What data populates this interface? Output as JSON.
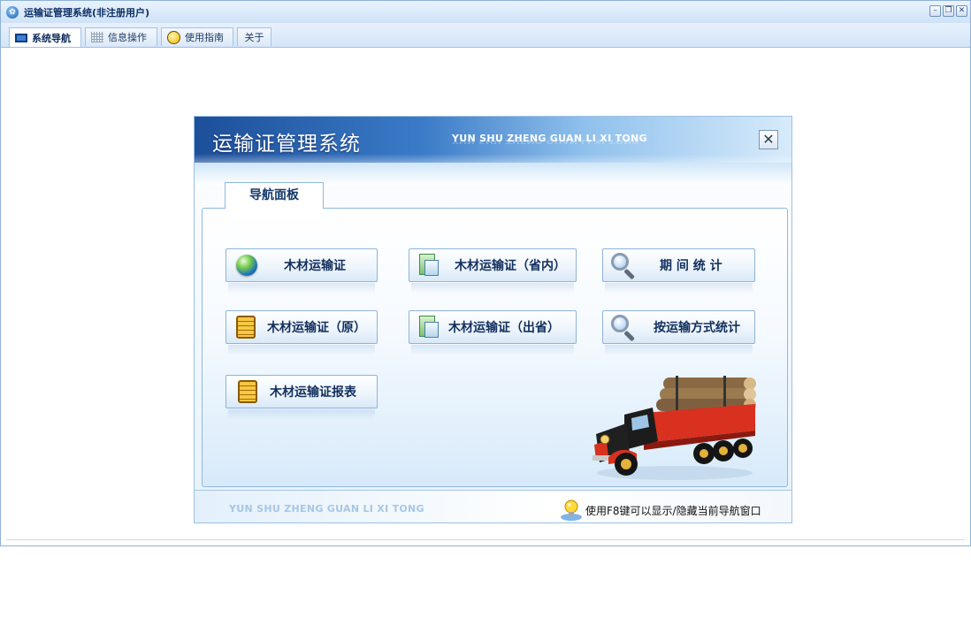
{
  "window": {
    "title": "运输证管理系统(非注册用户)",
    "app_icon": "app-logo-icon",
    "controls": {
      "minimize": "–",
      "restore": "❐",
      "close": "✕"
    }
  },
  "tabs": [
    {
      "label": "系统导航",
      "icon": "monitor-icon",
      "active": true
    },
    {
      "label": "信息操作",
      "icon": "grid-icon",
      "active": false
    },
    {
      "label": "使用指南",
      "icon": "help-icon",
      "active": false
    },
    {
      "label": "关于",
      "icon": "",
      "active": false
    }
  ],
  "dialog": {
    "title": "运输证管理系统",
    "subtitle": "YUN SHU ZHENG GUAN LI XI TONG",
    "close_label": "✕",
    "panel_tab": "导航面板",
    "buttons": {
      "b1": {
        "label": "木材运输证",
        "icon": "globe-icon"
      },
      "b2": {
        "label": "木材运输证（省内）",
        "icon": "card-icon"
      },
      "b3": {
        "label": "期 间 统 计",
        "icon": "magnifier-icon"
      },
      "b4": {
        "label": "木材运输证（原）",
        "icon": "document-icon"
      },
      "b5": {
        "label": "木材运输证（出省）",
        "icon": "card-icon"
      },
      "b6": {
        "label": "按运输方式统计",
        "icon": "magnifier-icon"
      },
      "b7": {
        "label": "木材运输证报表",
        "icon": "document-icon"
      }
    },
    "footer": {
      "brand": "YUN SHU ZHENG GUAN LI XI TONG",
      "hint": "使用F8键可以显示/隐藏当前导航窗口",
      "hint_icon": "lightbulb-icon"
    }
  },
  "colors": {
    "header_dark": "#1d4f9a",
    "header_light": "#d7ebfb",
    "button_border": "#8eb3da",
    "text_dark": "#122f5e"
  }
}
